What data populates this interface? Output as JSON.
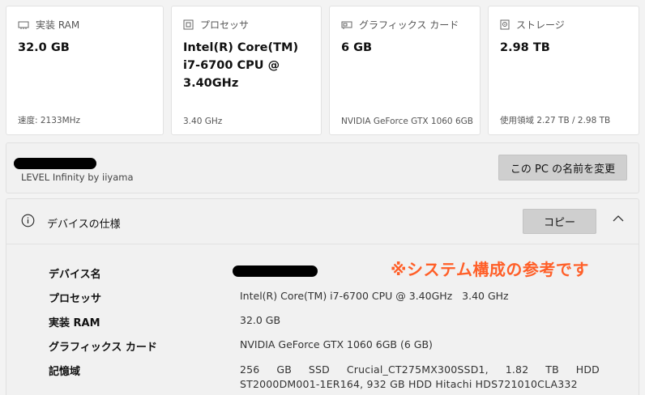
{
  "cards": [
    {
      "icon": "memory-icon",
      "title": "実装 RAM",
      "value": "32.0 GB",
      "footer": "速度: 2133MHz"
    },
    {
      "icon": "processor-icon",
      "title": "プロセッサ",
      "value": "Intel(R) Core(TM) i7-6700 CPU @ 3.40GHz",
      "footer": "3.40 GHz"
    },
    {
      "icon": "graphics-card-icon",
      "title": "グラフィックス カード",
      "value": "6 GB",
      "footer": "NVIDIA GeForce GTX 1060 6GB"
    },
    {
      "icon": "storage-icon",
      "title": "ストレージ",
      "value": "2.98 TB",
      "footer": "使用領域 2.27 TB / 2.98 TB"
    }
  ],
  "pc": {
    "model": "LEVEL Infinity by iiyama",
    "rename_label": "この PC の名前を変更"
  },
  "specs": {
    "title": "デバイスの仕様",
    "copy_label": "コピー",
    "annotation": "※システム構成の参考です",
    "rows": [
      {
        "label": "デバイス名",
        "value": ""
      },
      {
        "label": "プロセッサ",
        "value": "Intel(R) Core(TM) i7-6700 CPU @ 3.40GHz   3.40 GHz"
      },
      {
        "label": "実装 RAM",
        "value": "32.0 GB"
      },
      {
        "label": "グラフィックス カード",
        "value": "NVIDIA GeForce GTX 1060 6GB (6 GB)"
      },
      {
        "label": "記憶域",
        "value_lines": [
          "256 GB SSD Crucial_CT275MX300SSD1, 1.82 TB HDD",
          "ST2000DM001-1ER164, 932 GB HDD Hitachi HDS721010CLA332"
        ]
      }
    ]
  }
}
